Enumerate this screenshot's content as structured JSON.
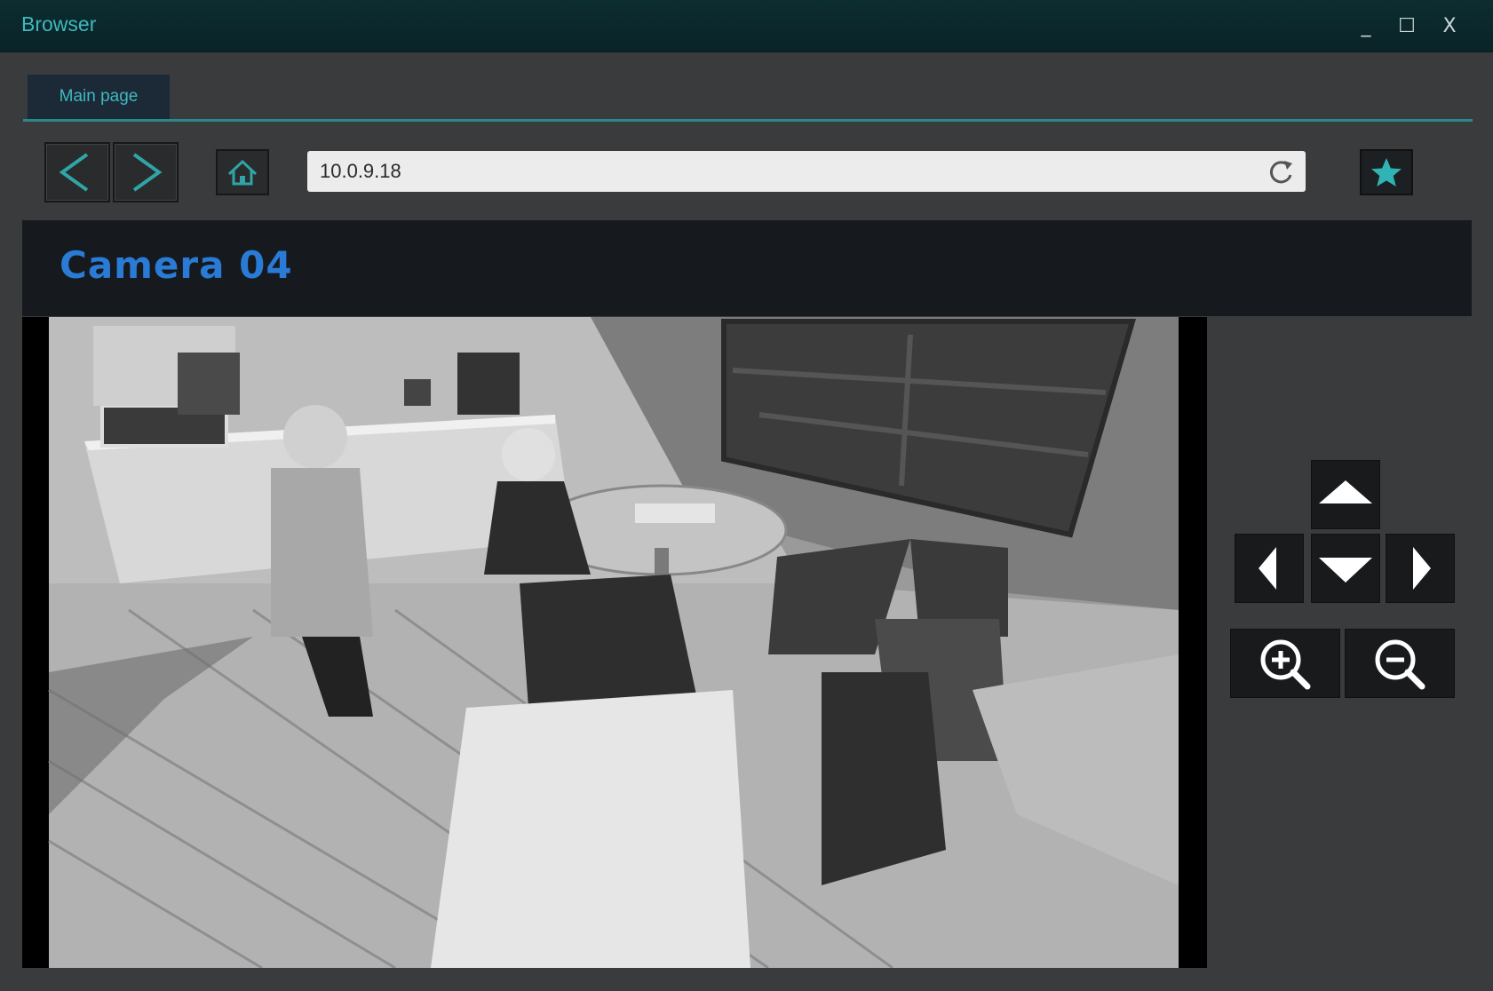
{
  "window": {
    "title": "Browser",
    "minimize_label": "_",
    "maximize_label": "☐",
    "close_label": "X"
  },
  "tabs": [
    {
      "label": "Main page",
      "active": true
    }
  ],
  "toolbar": {
    "back_icon": "chevron-left-icon",
    "forward_icon": "chevron-right-icon",
    "home_icon": "home-icon",
    "url": "10.0.9.18",
    "reload_icon": "reload-icon",
    "favorite_icon": "star-icon"
  },
  "page": {
    "title": "Camera 04",
    "feed": {
      "description_icon": "camera-feed-image",
      "mode": "grayscale"
    },
    "controls": {
      "pan_up_icon": "triangle-up-icon",
      "pan_left_icon": "triangle-left-icon",
      "pan_down_icon": "triangle-down-icon",
      "pan_right_icon": "triangle-right-icon",
      "zoom_in_icon": "zoom-in-icon",
      "zoom_out_icon": "zoom-out-icon"
    }
  },
  "colors": {
    "accent": "#3fb8bd",
    "title_blue": "#2a7bd6",
    "titlebar_bg": "#0c2d31",
    "panel_bg": "#3a3b3d",
    "header_bg": "#161a1f"
  }
}
